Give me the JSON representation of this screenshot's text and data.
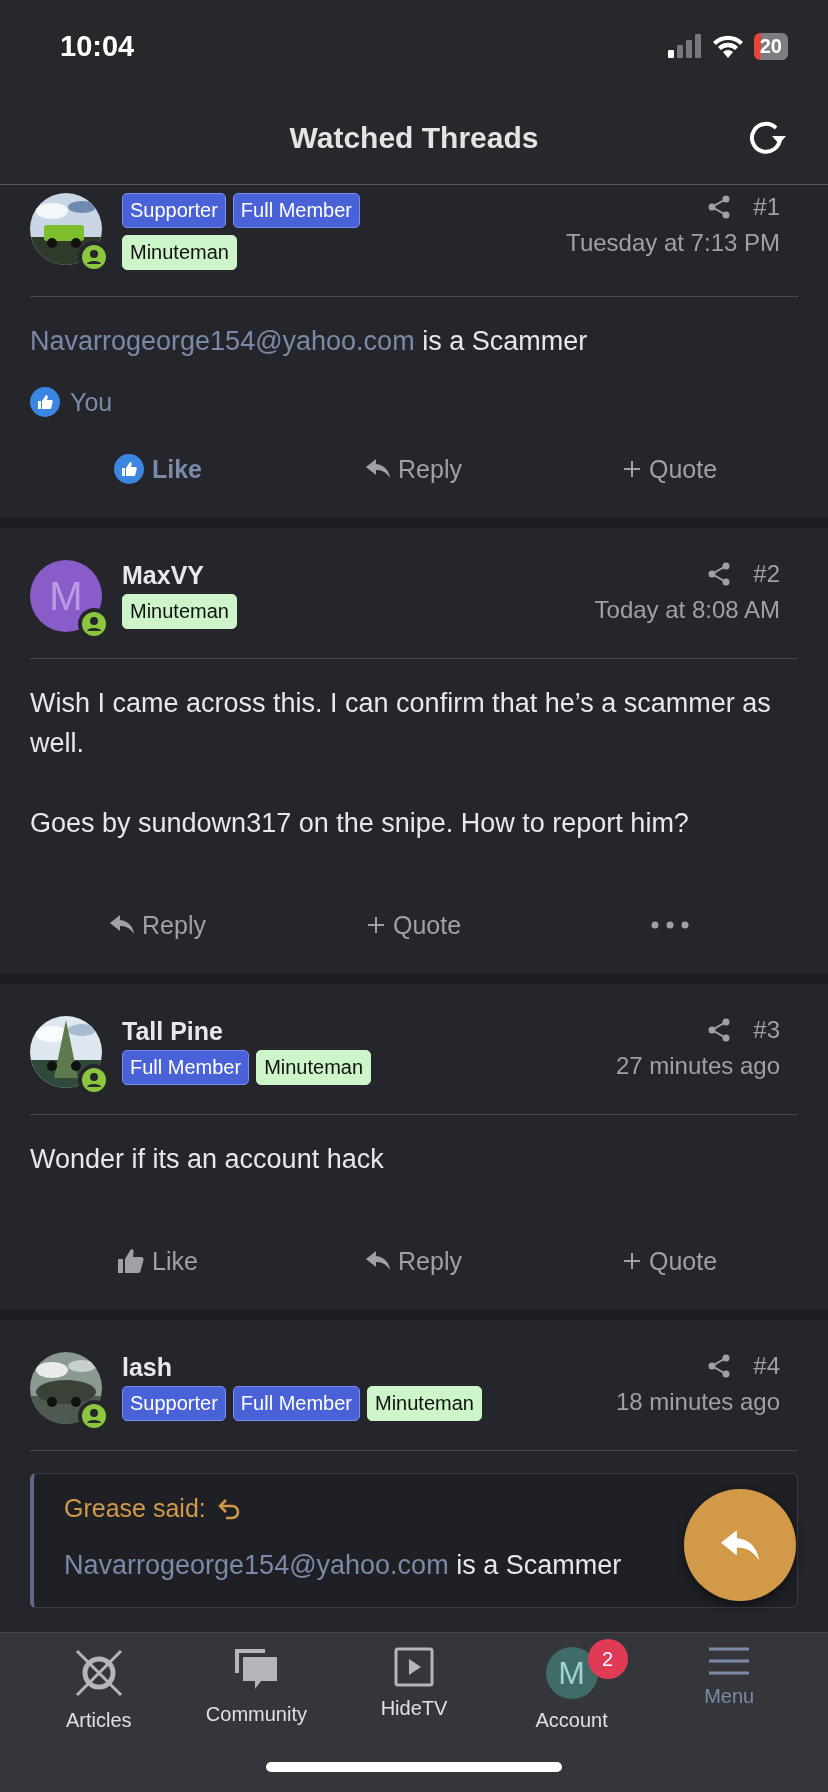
{
  "status_bar": {
    "time": "10:04",
    "battery": "20"
  },
  "header": {
    "title": "Watched Threads"
  },
  "posts": [
    {
      "avatar": {
        "kind": "picture"
      },
      "online": true,
      "badges": [
        {
          "label": "Supporter",
          "color": "#4a62d8"
        },
        {
          "label": "Full Member",
          "color": "#4a62d8"
        },
        {
          "label": "Minuteman",
          "color": "#cdf5c9"
        }
      ],
      "number": "#1",
      "time": "Tuesday at 7:13 PM",
      "body": [
        [
          {
            "kind": "link",
            "text": "Navarrogeorge154@yahoo.com"
          },
          {
            "kind": "text",
            "text": " is a Scammer"
          }
        ]
      ],
      "reactions": "You",
      "actions": [
        {
          "kind": "like",
          "label": "Like",
          "selected": true
        },
        {
          "kind": "reply",
          "label": "Reply"
        },
        {
          "kind": "quote",
          "label": "Quote"
        }
      ]
    },
    {
      "author": "MaxVY",
      "avatar": {
        "kind": "letter",
        "letter": "M"
      },
      "online": true,
      "badges": [
        {
          "label": "Minuteman",
          "color": "#cdf5c9"
        }
      ],
      "number": "#2",
      "time": "Today at 8:08 AM",
      "body": [
        [
          {
            "kind": "text",
            "text": "Wish I came across this. I can confirm that he’s a scammer as well."
          }
        ],
        [
          {
            "kind": "text",
            "text": "Goes by sundown317 on the snipe. How to report him?"
          }
        ]
      ],
      "actions": [
        {
          "kind": "reply",
          "label": "Reply"
        },
        {
          "kind": "quote",
          "label": "Quote"
        },
        {
          "kind": "more"
        }
      ]
    },
    {
      "author": "Tall Pine",
      "avatar": {
        "kind": "picture"
      },
      "online": true,
      "badges": [
        {
          "label": "Full Member",
          "color": "#4a62d8"
        },
        {
          "label": "Minuteman",
          "color": "#cdf5c9"
        }
      ],
      "number": "#3",
      "time": "27 minutes ago",
      "body": [
        [
          {
            "kind": "text",
            "text": "Wonder if its an account hack"
          }
        ]
      ],
      "actions": [
        {
          "kind": "like",
          "label": "Like",
          "selected": false
        },
        {
          "kind": "reply",
          "label": "Reply"
        },
        {
          "kind": "quote",
          "label": "Quote"
        }
      ]
    },
    {
      "author": "lash",
      "avatar": {
        "kind": "picture"
      },
      "online": true,
      "badges": [
        {
          "label": "Supporter",
          "color": "#4a62d8"
        },
        {
          "label": "Full Member",
          "color": "#4a62d8"
        },
        {
          "label": "Minuteman",
          "color": "#cdf5c9"
        }
      ],
      "number": "#4",
      "time": "18 minutes ago",
      "quote": {
        "author": "Grease said:",
        "body": [
          {
            "kind": "link",
            "text": "Navarrogeorge154@yahoo.com"
          },
          {
            "kind": "text",
            "text": " is a Scammer"
          }
        ]
      }
    }
  ],
  "nav": [
    {
      "kind": "articles",
      "label": "Articles",
      "selected": false
    },
    {
      "kind": "community",
      "label": "Community",
      "selected": false
    },
    {
      "kind": "tv",
      "label": "HideTV",
      "selected": false
    },
    {
      "kind": "account",
      "label": "Account",
      "selected": false,
      "letter": "M",
      "count": "2"
    },
    {
      "kind": "menu",
      "label": "Menu",
      "selected": true
    }
  ]
}
